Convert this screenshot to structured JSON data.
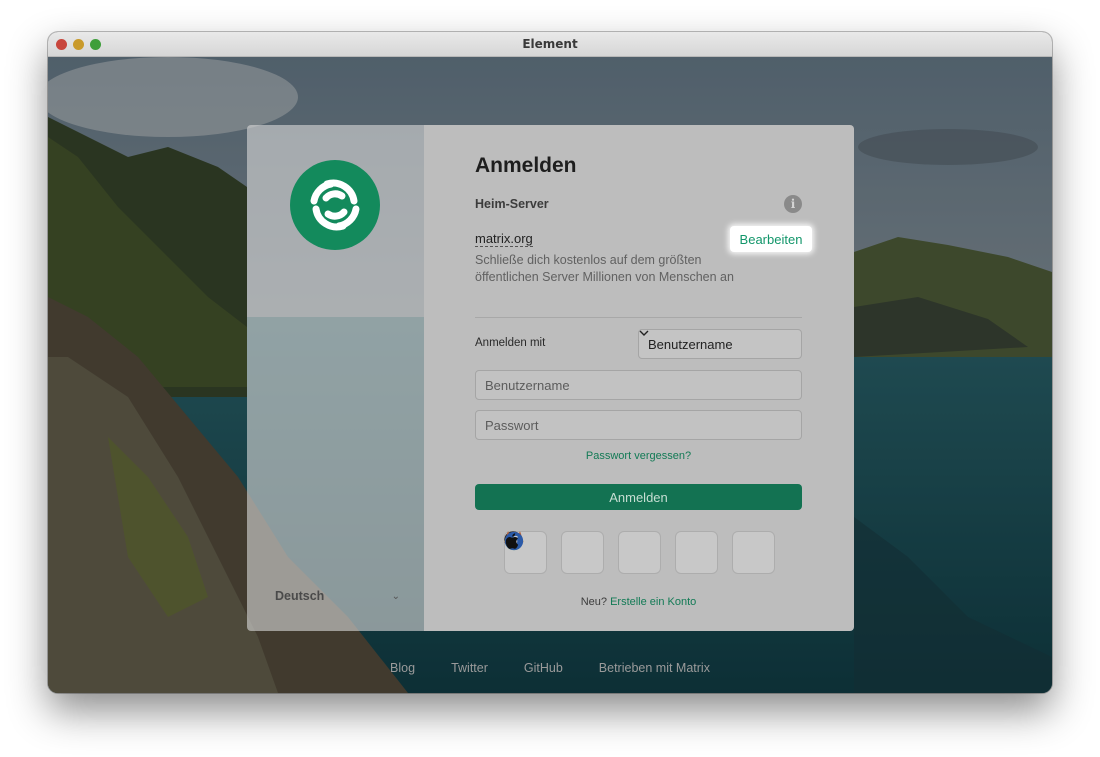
{
  "window": {
    "title": "Element"
  },
  "sidebar": {
    "language": "Deutsch"
  },
  "login": {
    "heading": "Anmelden",
    "homeserver_label": "Heim-Server",
    "server_name": "matrix.org",
    "edit_label": "Bearbeiten",
    "server_description": "Schließe dich kostenlos auf dem größten öffentlichen Server Millionen von Menschen an",
    "login_with_label": "Anmelden mit",
    "login_with_value": "Benutzername",
    "username_placeholder": "Benutzername",
    "password_placeholder": "Passwort",
    "forgot_password": "Passwort vergessen?",
    "submit_label": "Anmelden",
    "new_prefix": "Neu?",
    "create_account": "Erstelle ein Konto",
    "sso_providers": [
      "github",
      "google",
      "gitlab",
      "facebook",
      "apple"
    ]
  },
  "footer": {
    "links": [
      "Blog",
      "Twitter",
      "GitHub",
      "Betrieben mit Matrix"
    ]
  },
  "colors": {
    "accent": "#0dbd8b",
    "accent_dimmed": "#137252"
  }
}
